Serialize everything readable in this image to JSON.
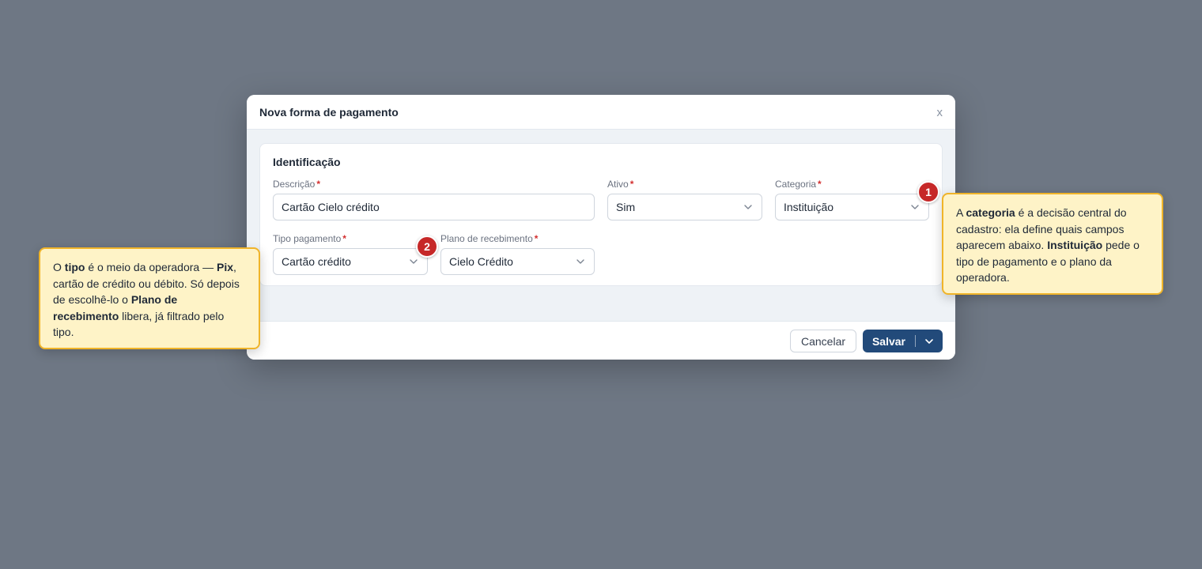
{
  "modal": {
    "title": "Nova forma de pagamento",
    "close_label": "x",
    "section_title": "Identificação",
    "required_marker": "*"
  },
  "fields": {
    "descricao": {
      "label": "Descrição",
      "value": "Cartão Cielo crédito"
    },
    "ativo": {
      "label": "Ativo",
      "value": "Sim"
    },
    "categoria": {
      "label": "Categoria",
      "value": "Instituição"
    },
    "tipo_pagamento": {
      "label": "Tipo pagamento",
      "value": "Cartão crédito"
    },
    "plano_recebimento": {
      "label": "Plano de recebimento",
      "value": "Cielo Crédito"
    }
  },
  "footer": {
    "cancel_label": "Cancelar",
    "save_label": "Salvar"
  },
  "badges": {
    "one": "1",
    "two": "2"
  },
  "callouts": {
    "right": {
      "t1": "A ",
      "b1": "categoria",
      "t2": " é a decisão central do cadastro: ela define quais campos aparecem abaixo. ",
      "b2": "Instituição",
      "t3": " pede o tipo de pagamento e o plano da operadora."
    },
    "left": {
      "t1": "O ",
      "b1": "tipo",
      "t2": " é o meio da operadora — ",
      "b2": "Pix",
      "t3": ", cartão de crédito ou débito. Só depois de escolhê-lo o ",
      "b3": "Plano de recebimento",
      "t4": " libera, já filtrado pelo tipo."
    }
  },
  "colors": {
    "backdrop": "#6e7784",
    "primary": "#224a7a",
    "required": "#d32f2f",
    "badge": "#c62828",
    "callout_bg": "#fef3c7",
    "callout_border": "#f0b429"
  },
  "icons": {
    "select_caret": "chevron-down-icon",
    "save_caret": "chevron-down-icon"
  }
}
